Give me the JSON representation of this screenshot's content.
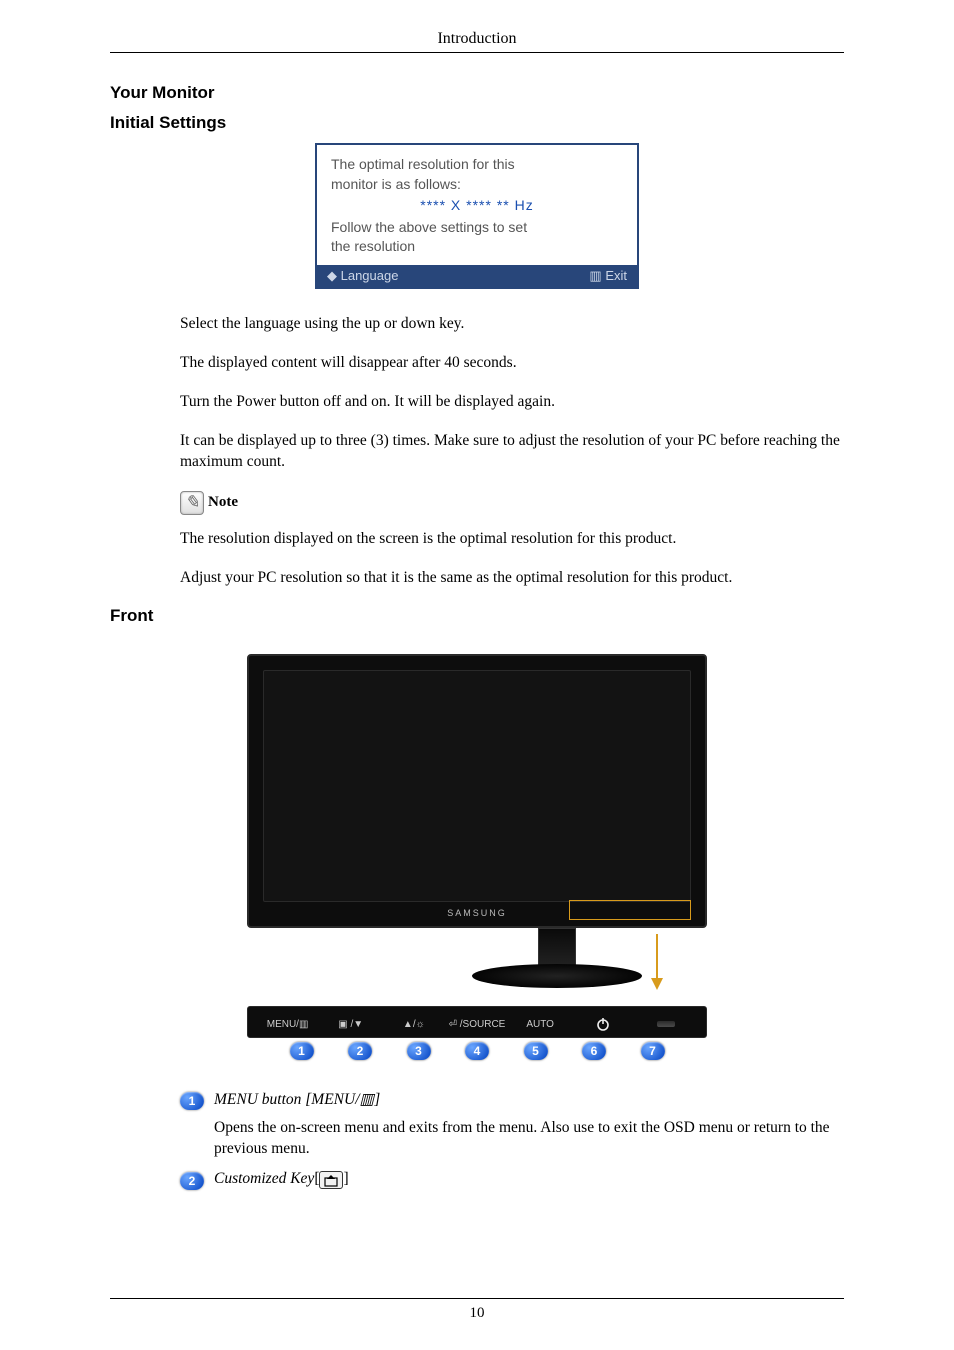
{
  "header": {
    "title": "Introduction"
  },
  "headings": {
    "your_monitor": "Your Monitor",
    "initial_settings": "Initial Settings",
    "front": "Front"
  },
  "osd": {
    "line1": "The optimal resolution for this",
    "line2": "monitor is as follows:",
    "hz": "**** X **** ** Hz",
    "line3": "Follow the above settings to set",
    "line4": "the resolution",
    "footer_left": "◆ Language",
    "footer_right": "▥ Exit"
  },
  "paragraphs": {
    "p1": "Select the language using the up or down key.",
    "p2": "The displayed content will disappear after 40 seconds.",
    "p3": "Turn the Power button off and on. It will be displayed again.",
    "p4": "It can be displayed up to three (3) times. Make sure to adjust the resolution of your PC before reaching the maximum count.",
    "p5": "The resolution displayed on the screen is the optimal resolution for this product.",
    "p6": "Adjust your PC resolution so that it is the same as the optimal resolution for this product."
  },
  "note": {
    "label": "Note"
  },
  "monitor": {
    "logo": "SAMSUNG",
    "buttons": {
      "b1": "MENU/▥",
      "b2": "▣ /▼",
      "b3": "▲/☼",
      "b4": "⏎ /SOURCE",
      "b5": "AUTO"
    },
    "numbers": [
      "1",
      "2",
      "3",
      "4",
      "5",
      "6",
      "7"
    ]
  },
  "legend": {
    "item1": {
      "num": "1",
      "title_pre": "MENU button [MENU/",
      "title_post": "]",
      "body": "Opens the on-screen menu and exits from the menu. Also use to exit the OSD menu or return to the previous menu."
    },
    "item2": {
      "num": "2",
      "title_pre": "Customized Key",
      "bracket_open": "[",
      "bracket_close": "]"
    }
  },
  "footer": {
    "page": "10"
  }
}
